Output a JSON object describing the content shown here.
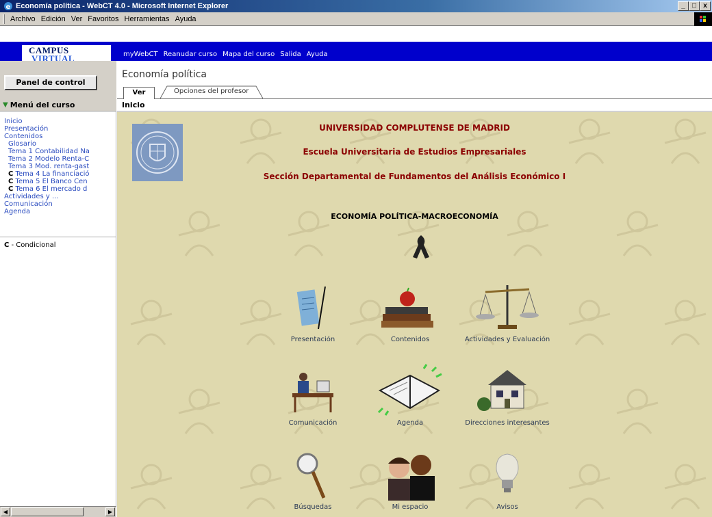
{
  "window": {
    "title": "Economía política - WebCT 4.0 - Microsoft Internet Explorer",
    "buttons": [
      "_",
      "□",
      "x"
    ]
  },
  "menubar": {
    "items": [
      "Archivo",
      "Edición",
      "Ver",
      "Favoritos",
      "Herramientas",
      "Ayuda"
    ]
  },
  "campus": {
    "line1": "CAMPUS",
    "line2": "VIRTUAL"
  },
  "nav": {
    "links": [
      "myWebCT",
      "Reanudar curso",
      "Mapa del curso",
      "Salida",
      "Ayuda"
    ]
  },
  "left": {
    "control_panel": "Panel de control",
    "menu_title": "Menú del curso",
    "items": [
      {
        "label": "Inicio",
        "indent": false,
        "cond": ""
      },
      {
        "label": "Presentación",
        "indent": false,
        "cond": ""
      },
      {
        "label": "Contenidos",
        "indent": false,
        "cond": ""
      },
      {
        "label": "Glosario",
        "indent": true,
        "cond": ""
      },
      {
        "label": "Tema 1 Contabilidad Na",
        "indent": true,
        "cond": ""
      },
      {
        "label": "Tema 2 Modelo Renta-C",
        "indent": true,
        "cond": ""
      },
      {
        "label": "Tema 3 Mod. renta-gast",
        "indent": true,
        "cond": ""
      },
      {
        "label": "Tema 4 La financiació",
        "indent": true,
        "cond": "C"
      },
      {
        "label": "Tema 5 El Banco Cen",
        "indent": true,
        "cond": "C"
      },
      {
        "label": "Tema 6 El mercado d",
        "indent": true,
        "cond": "C"
      },
      {
        "label": "Actividades y ...",
        "indent": false,
        "cond": ""
      },
      {
        "label": "Comunicación",
        "indent": false,
        "cond": ""
      },
      {
        "label": "Agenda",
        "indent": false,
        "cond": ""
      }
    ],
    "legend_key": "C",
    "legend_text": " - Condicional"
  },
  "course": {
    "title": "Economía política",
    "tabs": [
      "Ver",
      "Opciones del profesor"
    ],
    "breadcrumb": "Inicio"
  },
  "content": {
    "university": "UNIVERSIDAD COMPLUTENSE DE MADRID",
    "school": "Escuela Universitaria de Estudios Empresariales",
    "section": "Sección Departamental de Fundamentos del Análisis Económico I",
    "subject": "ECONOMÍA POLÍTICA-MACROECONOMÍA",
    "tiles": [
      {
        "label": "Presentación",
        "icon": "document-pen-icon"
      },
      {
        "label": "Contenidos",
        "icon": "books-apple-icon"
      },
      {
        "label": "Actividades y Evaluación",
        "icon": "scales-icon"
      },
      {
        "label": "Comunicación",
        "icon": "people-computer-icon"
      },
      {
        "label": "Agenda",
        "icon": "agenda-book-icon"
      },
      {
        "label": "Direcciones interesantes",
        "icon": "house-icon"
      },
      {
        "label": "Búsquedas",
        "icon": "magnifier-icon"
      },
      {
        "label": "Mi espacio",
        "icon": "people-photo-icon"
      },
      {
        "label": "Avisos",
        "icon": "lightbulb-icon"
      }
    ]
  },
  "colors": {
    "nav_blue": "#0000cc",
    "content_bg": "#dfd9ae",
    "header_red": "#8b0000",
    "link_blue": "#2a4bbf"
  }
}
